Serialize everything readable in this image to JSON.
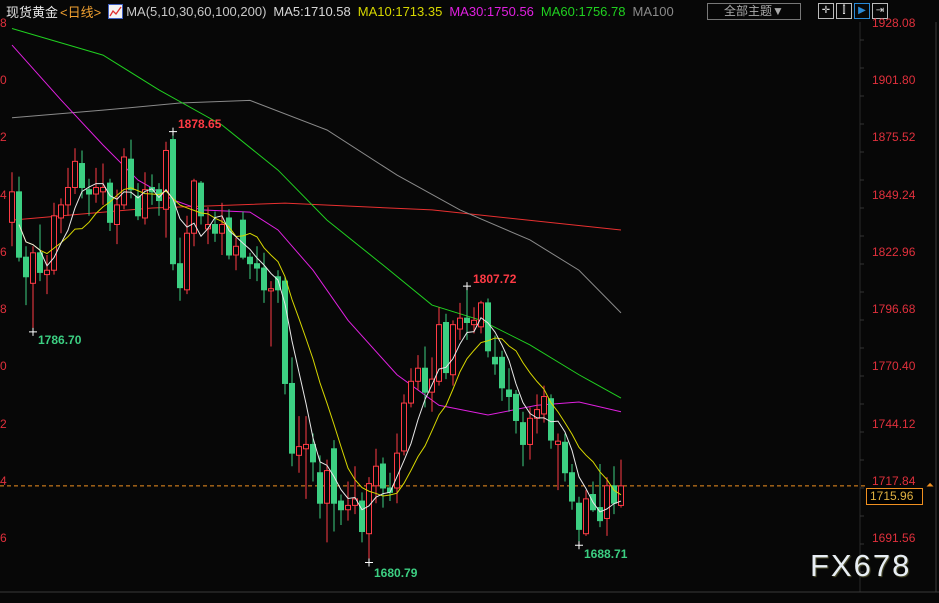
{
  "header": {
    "symbol": "现货黄金",
    "period": "<日线>",
    "indicator_icon": "chart-indicator-icon",
    "ma_params": "MA(5,10,30,60,100,200)",
    "ma5": "MA5:1710.58",
    "ma10": "MA10:1713.35",
    "ma30": "MA30:1750.56",
    "ma60": "MA60:1756.78",
    "ma100": "MA100",
    "theme_button": "全部主题▼",
    "tools": [
      "crosshair-icon",
      "range-select-icon",
      "play-icon",
      "move-right-icon"
    ]
  },
  "colors": {
    "up": "#ff3b45",
    "down": "#3ccf82",
    "ma5": "#e8e8e8",
    "ma10": "#d7d700",
    "ma30": "#e020e0",
    "ma60": "#20d020",
    "ma100": "#8a8a8a",
    "ma200": "#e83030",
    "last_price_line": "#f09020"
  },
  "watermark": "FX678",
  "last_price": "1715.96",
  "left_axis_fragments": [
    "8",
    "0",
    "2",
    "4",
    "6",
    "8",
    "0",
    "2",
    "4",
    "6"
  ],
  "chart_data": {
    "type": "candlestick",
    "title": "现货黄金 日线",
    "y_ticks": [
      "1928.08",
      "1901.80",
      "1875.52",
      "1849.24",
      "1822.96",
      "1796.68",
      "1770.40",
      "1744.12",
      "1717.84",
      "1691.56"
    ],
    "ylim": [
      1691.56,
      1928.08
    ],
    "annotations": {
      "high1": "1878.65",
      "low1": "1786.70",
      "high2": "1807.72",
      "low2": "1680.79",
      "low3": "1688.71"
    },
    "candles_ochl": [
      [
        1837,
        1851,
        1860,
        1826
      ],
      [
        1851,
        1821,
        1858,
        1819
      ],
      [
        1821,
        1812,
        1826,
        1799
      ],
      [
        1809,
        1823,
        1826,
        1786.7
      ],
      [
        1823,
        1814,
        1836,
        1810
      ],
      [
        1813,
        1815,
        1822,
        1804
      ],
      [
        1815,
        1840,
        1846,
        1813
      ],
      [
        1839,
        1845,
        1848,
        1832
      ],
      [
        1845,
        1853,
        1862,
        1840
      ],
      [
        1853,
        1865,
        1871,
        1850
      ],
      [
        1864,
        1853,
        1870,
        1848
      ],
      [
        1852,
        1850,
        1857,
        1840
      ],
      [
        1850,
        1853,
        1862,
        1846
      ],
      [
        1851,
        1853,
        1864,
        1845
      ],
      [
        1855,
        1837,
        1857,
        1833
      ],
      [
        1836,
        1845,
        1852,
        1827
      ],
      [
        1845,
        1867,
        1871,
        1843
      ],
      [
        1866,
        1852,
        1875,
        1848
      ],
      [
        1849,
        1840,
        1855,
        1838
      ],
      [
        1839,
        1852,
        1860,
        1836
      ],
      [
        1853,
        1851,
        1859,
        1845
      ],
      [
        1852,
        1847,
        1855,
        1840
      ],
      [
        1843,
        1870,
        1874,
        1830
      ],
      [
        1875,
        1818,
        1878.65,
        1815
      ],
      [
        1818,
        1807,
        1830,
        1801
      ],
      [
        1806,
        1832,
        1840,
        1804
      ],
      [
        1832,
        1856,
        1857,
        1826
      ],
      [
        1855,
        1840,
        1856,
        1836
      ],
      [
        1834,
        1836,
        1844,
        1827
      ],
      [
        1836,
        1832,
        1842,
        1828
      ],
      [
        1832,
        1836,
        1846,
        1822
      ],
      [
        1839,
        1822,
        1843,
        1820
      ],
      [
        1822,
        1826,
        1830,
        1815
      ],
      [
        1838,
        1821,
        1842,
        1820
      ],
      [
        1821,
        1818,
        1823,
        1811
      ],
      [
        1818,
        1816,
        1826,
        1810
      ],
      [
        1816,
        1806,
        1823,
        1800
      ],
      [
        1805.5,
        1806.5,
        1810,
        1780
      ],
      [
        1812,
        1806,
        1815,
        1800
      ],
      [
        1810,
        1763,
        1812,
        1758
      ],
      [
        1763,
        1731,
        1775,
        1725
      ],
      [
        1730,
        1734,
        1748,
        1722
      ],
      [
        1733,
        1735,
        1748,
        1710
      ],
      [
        1735,
        1727,
        1740,
        1718
      ],
      [
        1722,
        1708,
        1730,
        1701
      ],
      [
        1708,
        1723,
        1728,
        1690
      ],
      [
        1733,
        1708,
        1737,
        1695
      ],
      [
        1709,
        1705,
        1712,
        1698
      ],
      [
        1705,
        1707,
        1718,
        1700
      ],
      [
        1707,
        1710,
        1725,
        1703
      ],
      [
        1709,
        1695,
        1713,
        1690
      ],
      [
        1694,
        1717,
        1720,
        1680.79
      ],
      [
        1716,
        1725,
        1733,
        1708
      ],
      [
        1726,
        1715,
        1729,
        1706
      ],
      [
        1715,
        1713,
        1722,
        1709
      ],
      [
        1715,
        1731,
        1740,
        1708
      ],
      [
        1732,
        1754,
        1758,
        1730
      ],
      [
        1754,
        1764,
        1770,
        1752
      ],
      [
        1764,
        1770,
        1776,
        1760
      ],
      [
        1770,
        1759,
        1780,
        1752
      ],
      [
        1759,
        1765,
        1775,
        1750
      ],
      [
        1764,
        1790,
        1798,
        1762
      ],
      [
        1791,
        1768,
        1795,
        1765
      ],
      [
        1767,
        1790,
        1792,
        1762
      ],
      [
        1788,
        1793,
        1800,
        1783
      ],
      [
        1793,
        1791,
        1807.72,
        1783
      ],
      [
        1790,
        1792,
        1798,
        1786
      ],
      [
        1789,
        1800,
        1801,
        1786
      ],
      [
        1800,
        1778,
        1802,
        1775
      ],
      [
        1775,
        1772,
        1785,
        1767
      ],
      [
        1775,
        1761,
        1778,
        1755
      ],
      [
        1760,
        1757,
        1770,
        1750
      ],
      [
        1758,
        1746,
        1760,
        1740
      ],
      [
        1745,
        1735,
        1750,
        1725
      ],
      [
        1735,
        1747,
        1752,
        1728
      ],
      [
        1747,
        1751,
        1758,
        1740
      ],
      [
        1749,
        1757,
        1762,
        1745
      ],
      [
        1756,
        1737,
        1758,
        1733
      ],
      [
        1735,
        1736.5,
        1740,
        1714
      ],
      [
        1736,
        1722,
        1740,
        1718
      ],
      [
        1722,
        1709,
        1726,
        1705
      ],
      [
        1708,
        1696,
        1711,
        1688.71
      ],
      [
        1694,
        1710,
        1714,
        1693
      ],
      [
        1712,
        1705,
        1718,
        1704
      ],
      [
        1706,
        1700,
        1726,
        1697
      ],
      [
        1701,
        1716,
        1720,
        1693
      ],
      [
        1716,
        1708,
        1725,
        1703
      ],
      [
        1707,
        1715.96,
        1728,
        1706
      ]
    ],
    "ma_series": {
      "ma30": [
        [
          0,
          1918.4
        ],
        [
          7,
          1893.2
        ],
        [
          13,
          1872.5
        ],
        [
          18,
          1856.4
        ],
        [
          23,
          1847.3
        ],
        [
          27,
          1842.7
        ],
        [
          34,
          1841.7
        ],
        [
          38,
          1833.5
        ],
        [
          43,
          1815
        ],
        [
          48,
          1792
        ],
        [
          55,
          1767
        ],
        [
          61,
          1753
        ],
        [
          68,
          1748.5
        ],
        [
          75,
          1753
        ],
        [
          81,
          1754.5
        ],
        [
          87,
          1750
        ]
      ],
      "ma60": [
        [
          0,
          1926
        ],
        [
          13,
          1913.8
        ],
        [
          21,
          1897.8
        ],
        [
          30,
          1881.7
        ],
        [
          38,
          1861
        ],
        [
          45,
          1838
        ],
        [
          53,
          1817.4
        ],
        [
          60,
          1799
        ],
        [
          67,
          1792
        ],
        [
          74,
          1780.7
        ],
        [
          81,
          1767
        ],
        [
          87,
          1756.3
        ]
      ],
      "ma100": [
        [
          0,
          1885
        ],
        [
          13,
          1888.5
        ],
        [
          24,
          1891.8
        ],
        [
          34,
          1893
        ],
        [
          45,
          1879.4
        ],
        [
          55,
          1858.7
        ],
        [
          64,
          1842.7
        ],
        [
          74,
          1828.9
        ],
        [
          81,
          1815
        ],
        [
          87,
          1795.4
        ]
      ],
      "ma200": [
        [
          0,
          1838
        ],
        [
          20,
          1843.6
        ],
        [
          39,
          1845.8
        ],
        [
          60,
          1842.7
        ],
        [
          87,
          1833.5
        ]
      ]
    }
  }
}
